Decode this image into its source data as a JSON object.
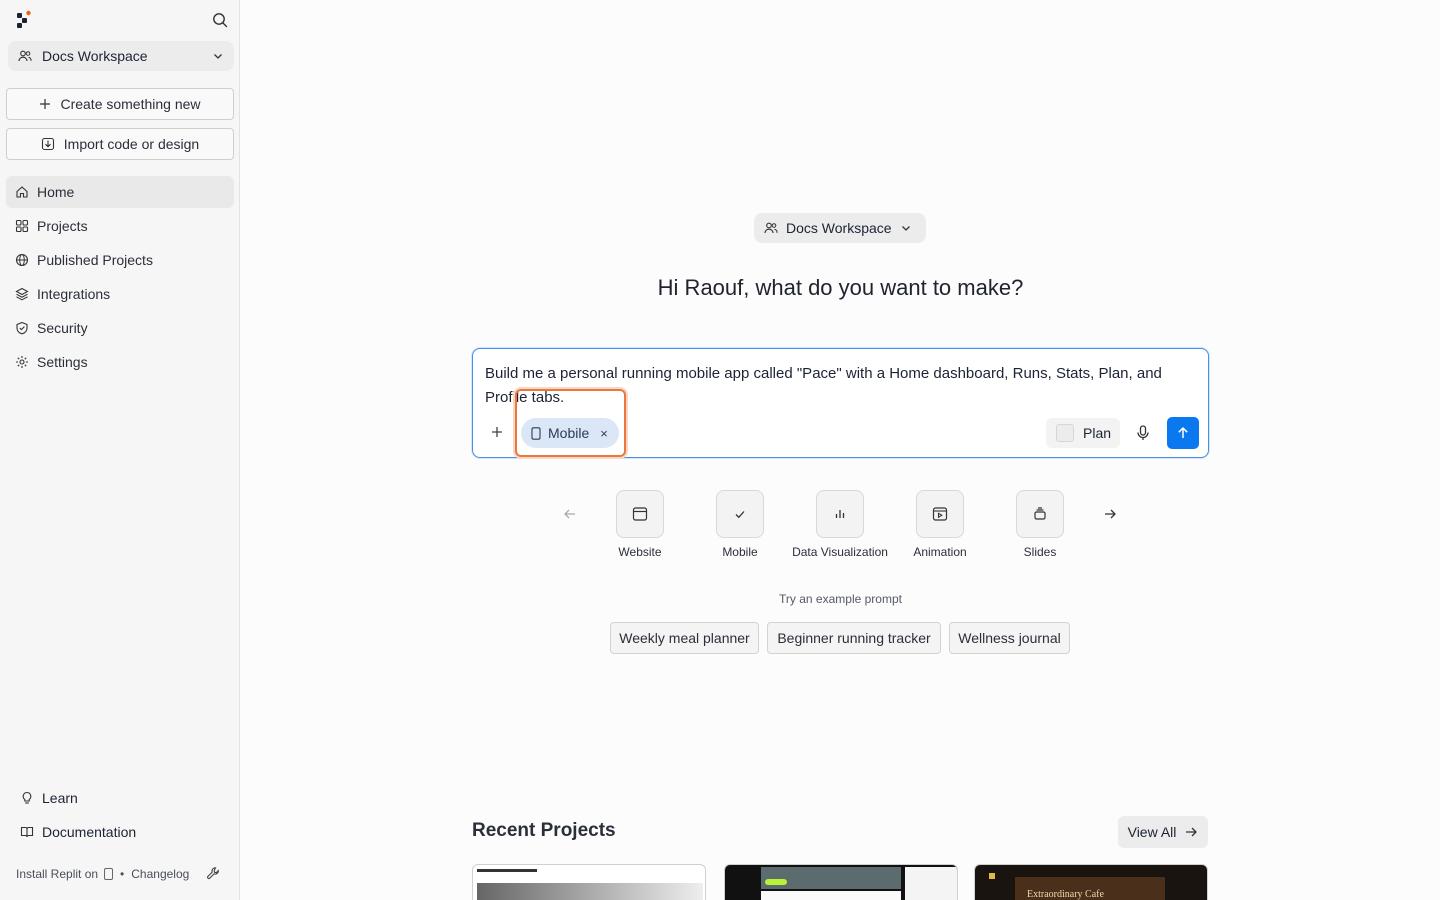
{
  "sidebar": {
    "workspace": "Docs Workspace",
    "create_label": "Create something new",
    "import_label": "Import code or design",
    "nav": [
      {
        "label": "Home",
        "icon": "home-icon",
        "active": true
      },
      {
        "label": "Projects",
        "icon": "grid-icon"
      },
      {
        "label": "Published Projects",
        "icon": "globe-icon"
      },
      {
        "label": "Integrations",
        "icon": "layers-icon"
      },
      {
        "label": "Security",
        "icon": "shield-icon"
      },
      {
        "label": "Settings",
        "icon": "gear-icon"
      }
    ],
    "learn": "Learn",
    "documentation": "Documentation",
    "install": "Install Replit on",
    "bullet": "•",
    "changelog": "Changelog"
  },
  "main": {
    "workspace": "Docs Workspace",
    "greeting": "Hi Raouf, what do you want to make?",
    "prompt": "Build me a personal running mobile app called \"Pace\" with a Home dashboard, Runs, Stats, Plan, and Profile tabs.",
    "chip_label": "Mobile",
    "chip_close": "×",
    "plan_label": "Plan",
    "categories": [
      {
        "label": "Website",
        "icon": "browser-icon"
      },
      {
        "label": "Mobile",
        "icon": "check-icon"
      },
      {
        "label": "Data Visualization",
        "icon": "bar-chart-icon"
      },
      {
        "label": "Animation",
        "icon": "play-frame-icon"
      },
      {
        "label": "Slides",
        "icon": "slides-icon"
      }
    ],
    "example_title": "Try an example prompt",
    "examples": [
      "Weekly meal planner",
      "Beginner running tracker",
      "Wellness journal"
    ],
    "recent_title": "Recent Projects",
    "view_all": "View All",
    "thumb_caption": "Extraordinary Cafe"
  },
  "colors": {
    "accent": "#0a79f0",
    "highlight": "#e8783e",
    "chip_bg": "#dbe7f7"
  }
}
